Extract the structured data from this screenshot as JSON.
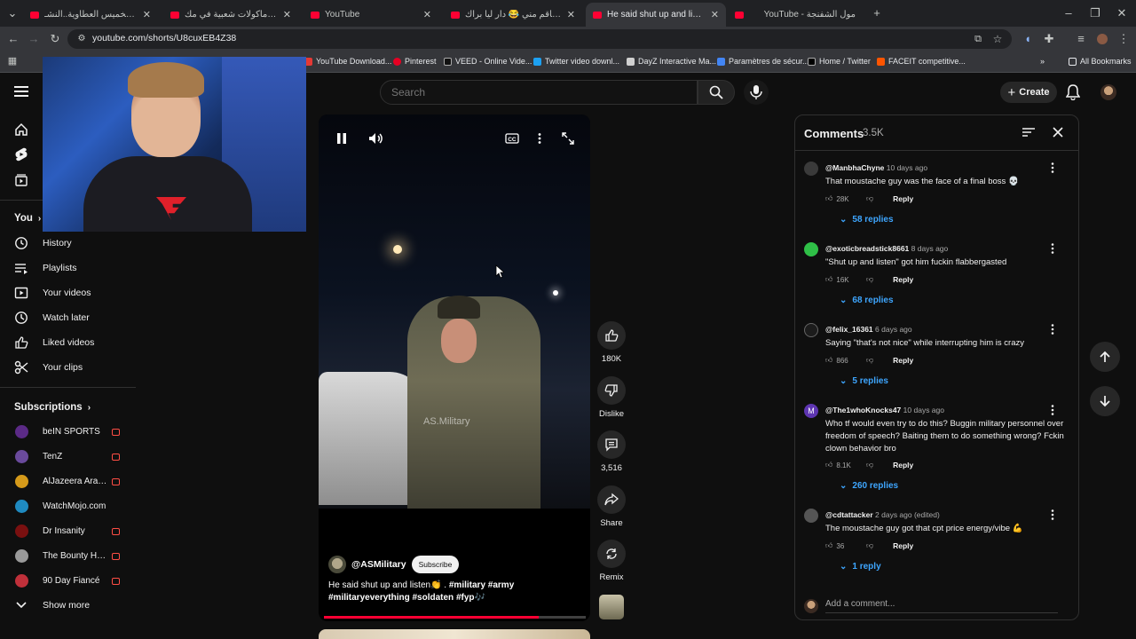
{
  "browser": {
    "tabs": [
      {
        "title": "في سوق الخميس العطاوية..النشـ"
      },
      {
        "title": "أشهى مأكولات شعبية في مك"
      },
      {
        "title": "YouTube"
      },
      {
        "title": "الوالية تتاقم مني 😂 دار ليا براك"
      },
      {
        "title": "He said shut up and listen👏"
      },
      {
        "title": "YouTube - مول الشفنجة"
      }
    ],
    "url": "youtube.com/shorts/U8cuxEB4Z38",
    "bookmarks": [
      {
        "label": "YouTube Download...",
        "color": "#e53935"
      },
      {
        "label": "Pinterest",
        "color": "#e60023"
      },
      {
        "label": "VEED - Online Vide...",
        "color": "#111111"
      },
      {
        "label": "Twitter video downl...",
        "color": "#1da1f2"
      },
      {
        "label": "DayZ Interactive Ma...",
        "color": "#d0d0d0"
      },
      {
        "label": "Paramètres de sécur...",
        "color": "#4285f4"
      },
      {
        "label": "Home / Twitter",
        "color": "#000000"
      },
      {
        "label": "FACEIT competitive...",
        "color": "#ff5500"
      }
    ],
    "all_bookmarks": "All Bookmarks"
  },
  "header": {
    "search_placeholder": "Search",
    "create_label": "Create"
  },
  "sidebar": {
    "you_label": "You",
    "you_items": [
      {
        "label": "History",
        "icon": "history-icon"
      },
      {
        "label": "Playlists",
        "icon": "playlists-icon"
      },
      {
        "label": "Your videos",
        "icon": "your-videos-icon"
      },
      {
        "label": "Watch later",
        "icon": "watch-later-icon"
      },
      {
        "label": "Liked videos",
        "icon": "liked-icon"
      },
      {
        "label": "Your clips",
        "icon": "clips-icon"
      }
    ],
    "subscriptions_label": "Subscriptions",
    "subscriptions": [
      {
        "label": "beIN SPORTS",
        "color": "#5b2a86"
      },
      {
        "label": "TenZ",
        "color": "#6a4a9c"
      },
      {
        "label": "AlJazeera Arabic...",
        "color": "#d59a1a"
      },
      {
        "label": "WatchMojo.com",
        "color": "#1f8ac0"
      },
      {
        "label": "Dr Insanity",
        "color": "#7a1010"
      },
      {
        "label": "The Bounty Hunt...",
        "color": "#9a9a9a"
      },
      {
        "label": "90 Day Fiancé",
        "color": "#c0303a"
      }
    ],
    "show_more": "Show more"
  },
  "short": {
    "watermark": "AS.Military",
    "channel": "@ASMilitary",
    "subscribe_label": "Subscribe",
    "caption_plain": "He said shut up and listen👏 .",
    "caption_tags": "#military #army #militaryeverything #soldaten #fyp🎶",
    "progress": 0.82
  },
  "rail": {
    "likes": "180K",
    "dislike": "Dislike",
    "comments": "3,516",
    "share": "Share",
    "remix": "Remix"
  },
  "comments_panel": {
    "title": "Comments",
    "count": "3.5K",
    "add_placeholder": "Add a comment...",
    "items": [
      {
        "user": "@ManbhaChyne",
        "time": "10 days ago",
        "text": "That moustache guy was the face of a final boss 💀",
        "likes": "28K",
        "reply": "Reply",
        "replies": "58 replies",
        "avatar": "#3a3a3a"
      },
      {
        "user": "@exoticbreadstick8661",
        "time": "8 days ago",
        "text": "\"Shut up and listen\" got him fuckin flabbergasted",
        "likes": "16K",
        "reply": "Reply",
        "replies": "68 replies",
        "avatar": "#2fbf47"
      },
      {
        "user": "@felix_16361",
        "time": "6 days ago",
        "text": "Saying \"that's not nice\" while interrupting him is crazy",
        "likes": "866",
        "reply": "Reply",
        "replies": "5 replies",
        "avatar": "#1c1c1c"
      },
      {
        "user": "@The1whoKnocks47",
        "time": "10 days ago",
        "text": "Who tf would even try to do this? Buggin military personnel over freedom of speech? Baiting them to do something wrong? Fckin clown behavior bro",
        "likes": "8.1K",
        "reply": "Reply",
        "replies": "260 replies",
        "avatar": "#5e35b1",
        "initial": "M"
      },
      {
        "user": "@cdtattacker",
        "time": "2 days ago (edited)",
        "text": "The moustache guy got that cpt price energy/vibe 💪",
        "likes": "36",
        "reply": "Reply",
        "replies": "1 reply",
        "avatar": "#555555"
      }
    ]
  }
}
